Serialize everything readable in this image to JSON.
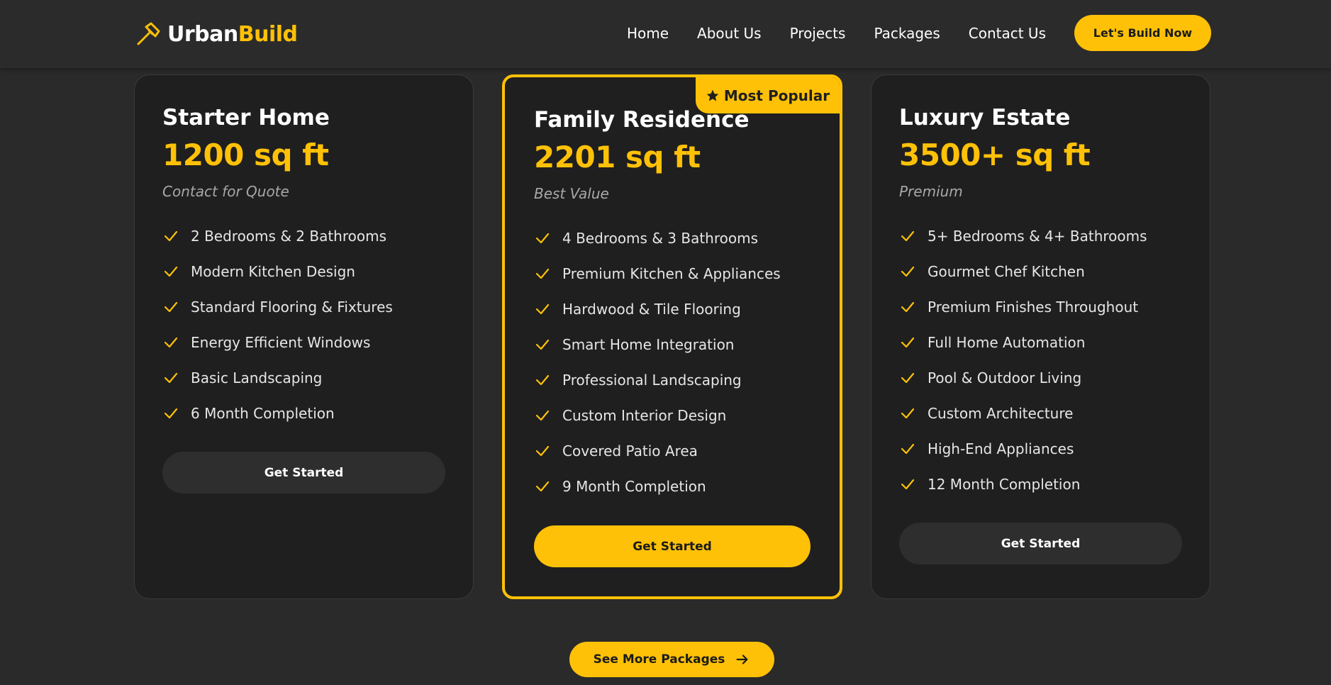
{
  "brand": {
    "part1": "Urban",
    "part2": "Build",
    "icon": "hammer-icon"
  },
  "nav": {
    "links": [
      "Home",
      "About Us",
      "Projects",
      "Packages",
      "Contact Us"
    ],
    "cta": "Let's Build Now"
  },
  "packages": [
    {
      "title": "Starter Home",
      "size": "1200 sq ft",
      "subtitle": "Contact for Quote",
      "features": [
        "2 Bedrooms & 2 Bathrooms",
        "Modern Kitchen Design",
        "Standard Flooring & Fixtures",
        "Energy Efficient Windows",
        "Basic Landscaping",
        "6 Month Completion"
      ],
      "button": "Get Started"
    },
    {
      "title": "Family Residence",
      "size": "2201 sq ft",
      "subtitle": "Best Value",
      "badge": "Most Popular",
      "features": [
        "4 Bedrooms & 3 Bathrooms",
        "Premium Kitchen & Appliances",
        "Hardwood & Tile Flooring",
        "Smart Home Integration",
        "Professional Landscaping",
        "Custom Interior Design",
        "Covered Patio Area",
        "9 Month Completion"
      ],
      "button": "Get Started"
    },
    {
      "title": "Luxury Estate",
      "size": "3500+ sq ft",
      "subtitle": "Premium",
      "features": [
        "5+ Bedrooms & 4+ Bathrooms",
        "Gourmet Chef Kitchen",
        "Premium Finishes Throughout",
        "Full Home Automation",
        "Pool & Outdoor Living",
        "Custom Architecture",
        "High-End Appliances",
        "12 Month Completion"
      ],
      "button": "Get Started"
    }
  ],
  "see_more": "See More Packages",
  "colors": {
    "accent": "#FFC107",
    "background": "#2a2a2a",
    "card": "#1f1f1f"
  }
}
